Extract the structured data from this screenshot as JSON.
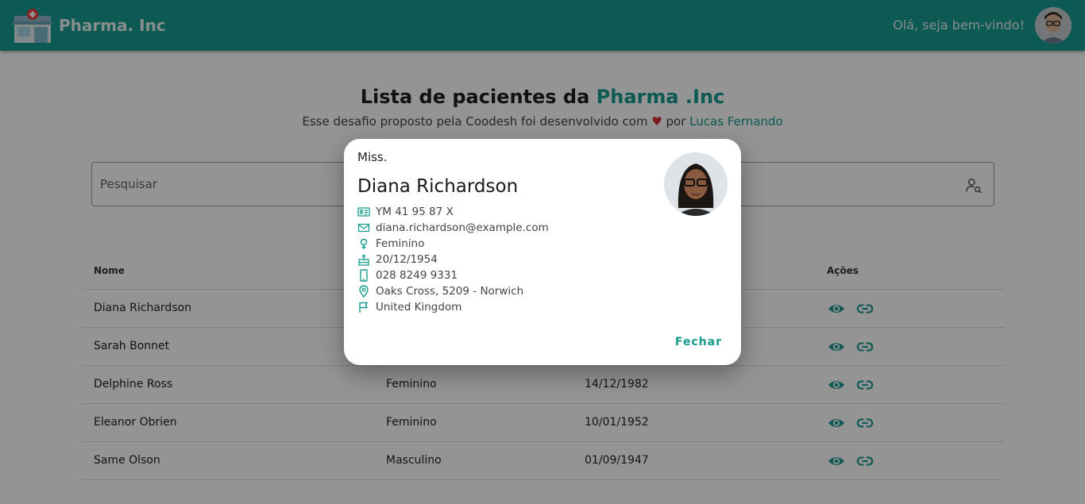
{
  "header": {
    "brand": "Pharma. Inc",
    "greeting": "Olá, seja bem-vindo!"
  },
  "page": {
    "title_prefix": "Lista de pacientes da ",
    "title_accent": "Pharma .Inc",
    "subtitle_prefix": "Esse desafio proposto pela Coodesh foi desenvolvido com ",
    "subtitle_heart": "♥",
    "subtitle_middle": " por ",
    "subtitle_author": "Lucas Fernando"
  },
  "search": {
    "placeholder": "Pesquisar",
    "icon": "user-search-icon"
  },
  "table": {
    "headers": {
      "name": "Nome",
      "actions": "Ações"
    },
    "rows": [
      {
        "name": "Diana Richardson",
        "gender": "",
        "birth": ""
      },
      {
        "name": "Sarah Bonnet",
        "gender": "",
        "birth": ""
      },
      {
        "name": "Delphine Ross",
        "gender": "Feminino",
        "birth": "14/12/1982"
      },
      {
        "name": "Eleanor Obrien",
        "gender": "Feminino",
        "birth": "10/01/1952"
      },
      {
        "name": "Same Olson",
        "gender": "Masculino",
        "birth": "01/09/1947"
      }
    ]
  },
  "modal": {
    "title": "Miss.",
    "name": "Diana Richardson",
    "info": [
      {
        "icon": "id-card-icon",
        "text": "YM 41 95 87 X"
      },
      {
        "icon": "email-icon",
        "text": "diana.richardson@example.com"
      },
      {
        "icon": "female-icon",
        "text": "Feminino"
      },
      {
        "icon": "cake-icon",
        "text": "20/12/1954"
      },
      {
        "icon": "phone-icon",
        "text": "028 8249 9331"
      },
      {
        "icon": "location-pin-icon",
        "text": "Oaks Cross, 5209 - Norwich"
      },
      {
        "icon": "flag-icon",
        "text": "United Kingdom"
      }
    ],
    "close_label": "Fechar"
  },
  "colors": {
    "primary": "#179a8f",
    "heart": "#d32f2f"
  }
}
